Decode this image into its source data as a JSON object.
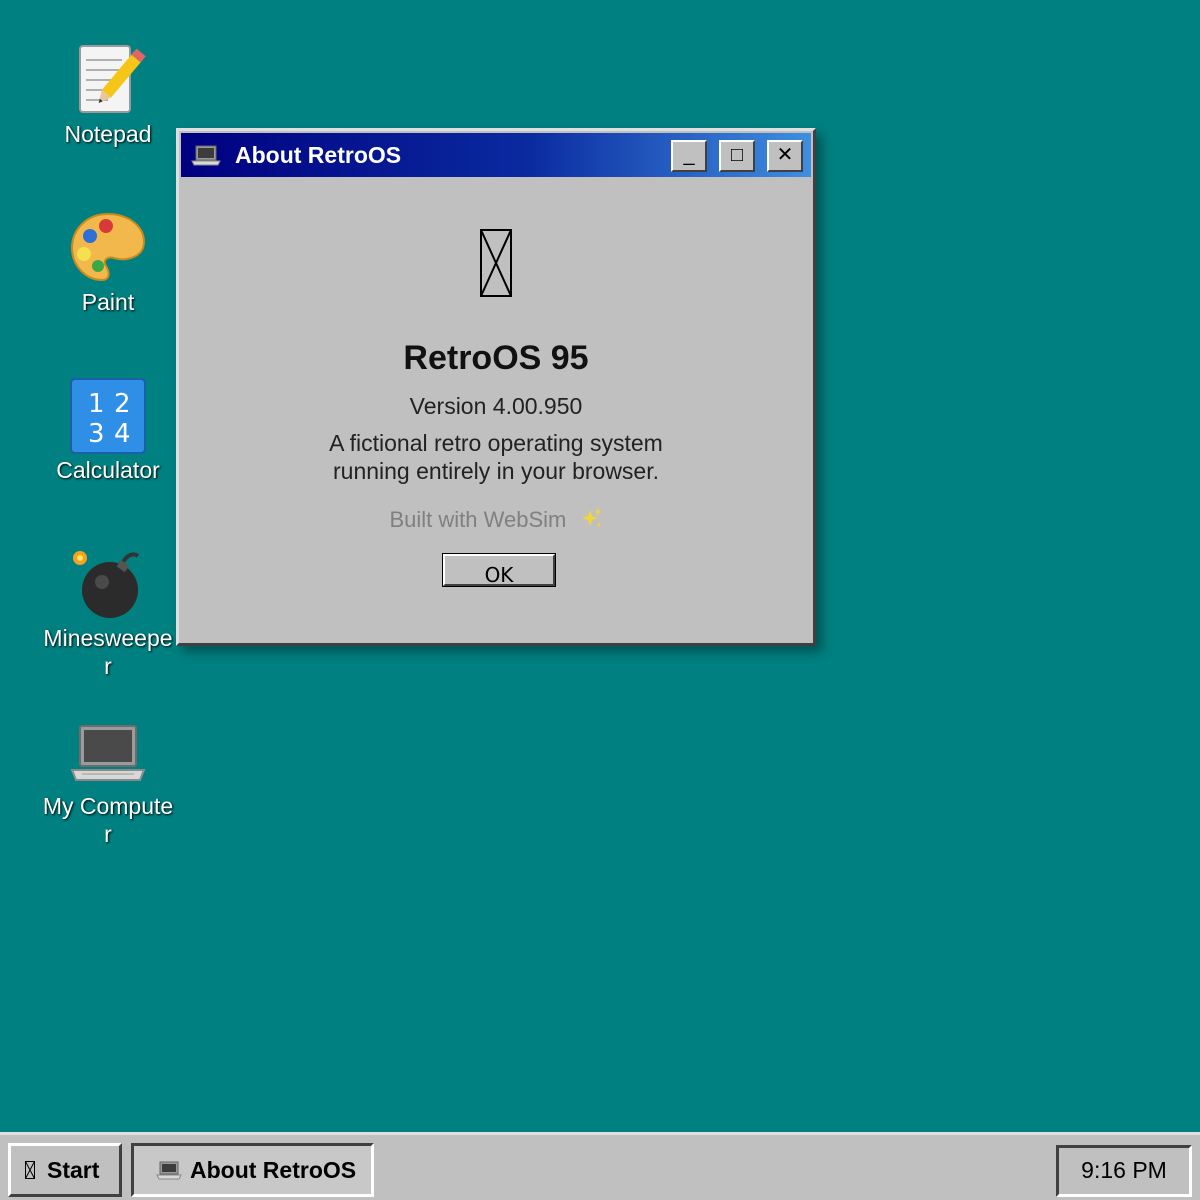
{
  "desktop": {
    "background_color": "#008080",
    "icons": [
      {
        "label": "Notepad",
        "icon": "notepad-icon"
      },
      {
        "label": "Paint",
        "icon": "palette-icon"
      },
      {
        "label": "Calculator",
        "icon": "calculator-icon"
      },
      {
        "label": "Minesweeper",
        "icon": "bomb-icon"
      },
      {
        "label": "My Computer",
        "icon": "laptop-icon"
      }
    ]
  },
  "window": {
    "title": "About RetroOS",
    "title_icon": "laptop-icon",
    "controls": {
      "minimize": "_",
      "maximize": "□",
      "close": "✕"
    },
    "body": {
      "logo_icon": "missing-glyph-icon",
      "product_name": "RetroOS 95",
      "version": "Version 4.00.950",
      "description_line1": "A fictional retro operating system",
      "description_line2": "running entirely in your browser.",
      "built_with": "Built with WebSim",
      "built_with_icon": "sparkles-icon",
      "ok_label": "OK"
    }
  },
  "taskbar": {
    "start_label": "Start",
    "task_label": "About RetroOS",
    "task_icon": "laptop-icon",
    "clock": "9:16 PM"
  }
}
